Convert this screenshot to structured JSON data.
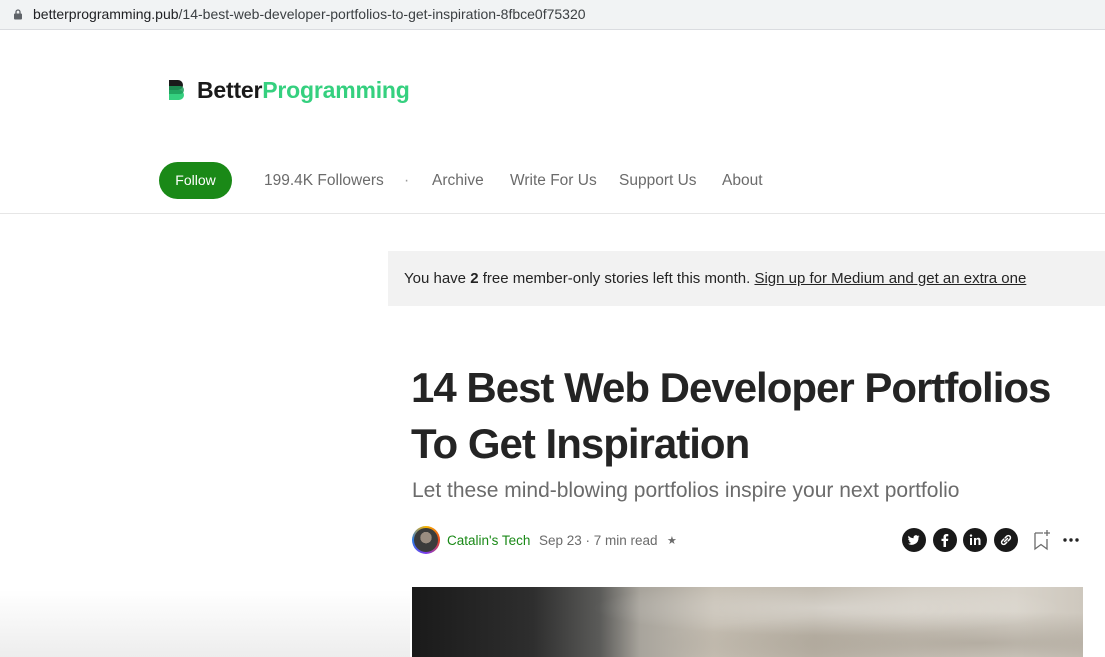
{
  "browser": {
    "url_host": "betterprogramming.pub",
    "url_path": "/14-best-web-developer-portfolios-to-get-inspiration-8fbce0f75320"
  },
  "brand": {
    "part1": "Better",
    "part2": "Programming",
    "accent_color": "#35d07f"
  },
  "pub_nav": {
    "follow_label": "Follow",
    "followers": "199.4K Followers",
    "separator": "·",
    "items": [
      "Archive",
      "Write For Us",
      "Support Us",
      "About"
    ]
  },
  "banner": {
    "prefix": "You have ",
    "count": "2",
    "suffix": " free member-only stories left this month. ",
    "link": "Sign up for Medium and get an extra one"
  },
  "article": {
    "title": "14 Best Web Developer Portfolios To Get Inspiration",
    "subtitle": "Let these mind-blowing portfolios inspire your next portfolio",
    "author": "Catalin's Tech",
    "meta": "Sep 23 · 7 min read",
    "member_star": "★"
  },
  "share_icons": [
    "twitter-icon",
    "facebook-icon",
    "linkedin-icon",
    "link-icon",
    "bookmark-icon",
    "more-icon"
  ],
  "colors": {
    "follow_button": "#1a8917",
    "author_link": "#1a8917"
  }
}
